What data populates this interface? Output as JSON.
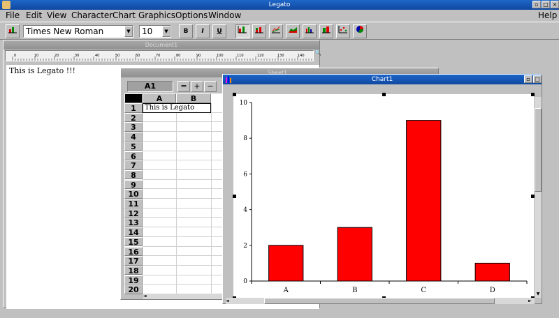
{
  "app": {
    "title": "Legato"
  },
  "menu": {
    "items": [
      "File",
      "Edit",
      "View",
      "Character",
      "Chart",
      "Graphics",
      "Options",
      "Window"
    ],
    "help": "Help"
  },
  "toolbar": {
    "font_family": "Times New Roman",
    "font_size": "10",
    "bold_label": "B",
    "italic_label": "I",
    "underline_label": "U"
  },
  "document": {
    "title": "Document1",
    "text": "This is Legato !!!",
    "ruler_labels": [
      "0",
      "10",
      "20",
      "30",
      "40",
      "50",
      "60",
      "70",
      "80",
      "90",
      "100",
      "110",
      "120",
      "130",
      "140"
    ]
  },
  "sheet": {
    "title": "Sheet1",
    "cell_ref": "A1",
    "formula_buttons": [
      "=",
      "+",
      "−"
    ],
    "columns": [
      "A",
      "B"
    ],
    "rows": [
      "1",
      "2",
      "3",
      "4",
      "5",
      "6",
      "7",
      "8",
      "9",
      "10",
      "11",
      "12",
      "13",
      "14",
      "15",
      "16",
      "17",
      "18",
      "19",
      "20"
    ],
    "cell_a1": "This is Legato"
  },
  "chart": {
    "title": "Chart1",
    "chart_data": {
      "type": "bar",
      "categories": [
        "A",
        "B",
        "C",
        "D"
      ],
      "values": [
        2,
        3,
        9,
        1
      ],
      "ylim": [
        0,
        10
      ],
      "yticks": [
        0,
        2,
        4,
        6,
        8,
        10
      ],
      "bar_color": "#ff0000",
      "grid": false
    }
  }
}
